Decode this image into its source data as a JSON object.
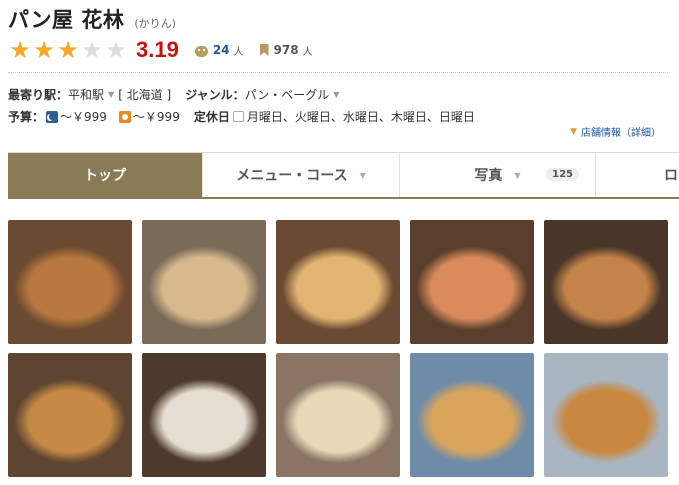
{
  "header": {
    "shop_name": "パン屋 花林",
    "reading": "(かりん)"
  },
  "rating": {
    "score": "3.19",
    "stars_filled": 3,
    "stars_total": 5,
    "review_count": "24",
    "review_unit": "人",
    "saved_count": "978",
    "saved_unit": "人"
  },
  "info": {
    "station_label": "最寄り駅：",
    "station": "平和駅",
    "area": "[ 北海道 ]",
    "genre_label": "ジャンル：",
    "genre_1": "パン",
    "genre_sep": "・",
    "genre_2": "ベーグル",
    "budget_label": "予算：",
    "dinner_budget": "～￥999",
    "lunch_budget": "～￥999",
    "holiday_label": "定休日",
    "holidays": "月曜日、火曜日、水曜日、木曜日、日曜日",
    "shop_info_link": "店舗情報（詳細）"
  },
  "tabs": [
    {
      "label": "トップ",
      "active": true
    },
    {
      "label": "メニュー・コース",
      "active": false
    },
    {
      "label": "写真",
      "active": false,
      "badge": "125"
    },
    {
      "label": "ロ",
      "active": false
    }
  ],
  "photos": [
    {
      "name": "croissant-photo",
      "bg": "#6a4a30",
      "fg": "#b9783f"
    },
    {
      "name": "melon-pan-photo",
      "bg": "#7a6a58",
      "fg": "#d8b98d"
    },
    {
      "name": "topped-bread-photo",
      "bg": "#6b4a33",
      "fg": "#e2b472"
    },
    {
      "name": "hot-dog-photo",
      "bg": "#5a3f2c",
      "fg": "#d98a5a"
    },
    {
      "name": "salt-roll-photo",
      "bg": "#4a3628",
      "fg": "#c4834a"
    },
    {
      "name": "pastry-photo",
      "bg": "#5e4531",
      "fg": "#c68a46"
    },
    {
      "name": "white-bread-photo",
      "bg": "#4d3a2c",
      "fg": "#e5ddd0"
    },
    {
      "name": "cream-bread-photo",
      "bg": "#8a7565",
      "fg": "#e9d9b8"
    },
    {
      "name": "bagged-bread-photo",
      "bg": "#6f8ba8",
      "fg": "#d9a55c"
    },
    {
      "name": "bagged-croissant-photo",
      "bg": "#a9b6c2",
      "fg": "#c98740"
    }
  ]
}
